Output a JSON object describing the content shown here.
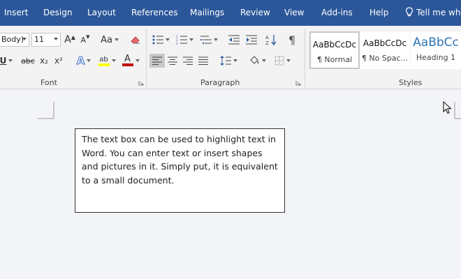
{
  "menu": {
    "tabs": [
      "Insert",
      "Design",
      "Layout",
      "References",
      "Mailings",
      "Review",
      "View",
      "Add-ins",
      "Help"
    ],
    "tell_me": "Tell me wha"
  },
  "font_group": {
    "label": "Font",
    "font_name": "Body)",
    "font_size": "11",
    "change_case": "Aa",
    "underline": "U",
    "strikethrough": "abc",
    "subscript": "x₂",
    "superscript": "x²",
    "grow_font": "A",
    "shrink_font": "A",
    "text_effects": "A",
    "highlight": "ab",
    "font_color": "A"
  },
  "paragraph_group": {
    "label": "Paragraph",
    "pilcrow": "¶"
  },
  "styles_group": {
    "label": "Styles",
    "items": [
      {
        "preview": "AaBbCcDc",
        "name": "¶ Normal"
      },
      {
        "preview": "AaBbCcDc",
        "name": "¶ No Spac..."
      },
      {
        "preview": "AaBbCc",
        "name": "Heading 1"
      }
    ]
  },
  "document": {
    "textbox_text": "The text box can be used to highlight text in Word. You can enter text or insert shapes and pictures in it. Simply put, it is equivalent to a small document."
  },
  "colors": {
    "ribbon_tab_bar": "#2b579a",
    "highlight_yellow": "#ffff00",
    "font_color_red": "#c00000",
    "heading_blue": "#2e74b5"
  }
}
